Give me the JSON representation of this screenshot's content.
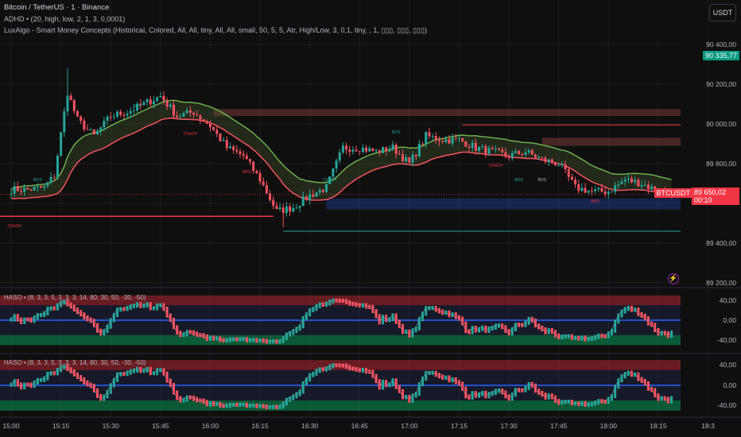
{
  "header": {
    "symbol_title": "Bitcoin / TetherUS · 1 · Binance",
    "indicator_1": "ADHD • (20, high, low, 2, 1, 3, 0,0001)",
    "indicator_2": "LuxAlgo - Smart Money Concepts (Historical, Colored, All, All, tiny, All, All, small, 50, 5, 5, Atr, High/Low, 3, 0,1, tiny, , 1, ▯▯▯, ▯▯▯, ▯▯▯)",
    "currency_button": "USDT"
  },
  "price_axis": {
    "labels": [
      "90 400,00",
      "90 200,00",
      "90 000,00",
      "89 800,00",
      "89 400,00",
      "89 200,00"
    ],
    "values": [
      90400,
      90200,
      90000,
      89800,
      89400,
      89200
    ]
  },
  "price_tags": {
    "high_tag": "90 335,77",
    "symbol_tag": "BTCUSDT",
    "last_price": "89 650,02",
    "countdown": "00:10"
  },
  "oscillator_panes": [
    {
      "title": "HASO • (8, 3, 3, 5, 3, 3, 3, 14, 80, 30, 50, -30, -50)",
      "labels": [
        "40,00",
        "0,00",
        "-40,00"
      ]
    },
    {
      "title": "HASO • (8, 3, 3, 5, 3, 3, 3, 14, 80, 30, 50, -30, -50)",
      "labels": [
        "40,00",
        "0,00",
        "-40,00"
      ]
    }
  ],
  "time_axis": [
    "15:00",
    "15:15",
    "15:30",
    "15:45",
    "16:00",
    "16:15",
    "16:30",
    "16:45",
    "17:00",
    "17:15",
    "17:30",
    "17:45",
    "18:00",
    "18:15",
    "18:3"
  ],
  "smc_labels": [
    {
      "text": "BOS",
      "color": "#26a69a",
      "minute": 8,
      "price": 89730
    },
    {
      "text": "BOS",
      "color": "#26a69a",
      "minute": 38,
      "price": 90100
    },
    {
      "text": "CHoCH",
      "color": "#f23645",
      "minute": 54,
      "price": 89960
    },
    {
      "text": "BOS",
      "color": "#f23645",
      "minute": 71,
      "price": 89770
    },
    {
      "text": "CHoCH",
      "color": "#26a69a",
      "minute": 96,
      "price": 89730
    },
    {
      "text": "CHoCH",
      "color": "#f23645",
      "minute": 1,
      "price": 89495
    },
    {
      "text": "BOS",
      "color": "#26a69a",
      "minute": 116,
      "price": 89970
    },
    {
      "text": "CHoCH",
      "color": "#f23645",
      "minute": 146,
      "price": 89800
    },
    {
      "text": "BOS",
      "color": "#26a69a",
      "minute": 153,
      "price": 89730
    },
    {
      "text": "BOS",
      "color": "#b2b5be",
      "minute": 160,
      "price": 89730
    },
    {
      "text": "BOS",
      "color": "#f23645",
      "minute": 176,
      "price": 89620
    }
  ],
  "colors": {
    "up": "#26a69a",
    "down": "#f7525f",
    "background": "#0f0f0f",
    "tag_green": "#089981",
    "tag_red": "#f23645"
  },
  "chart_data": {
    "type": "candlestick",
    "interval_minutes": 1,
    "start_time": "15:00",
    "keyframes_minute": [
      0,
      5,
      10,
      13,
      17,
      20,
      25,
      30,
      35,
      40,
      45,
      50,
      55,
      60,
      65,
      70,
      75,
      80,
      85,
      90,
      95,
      100,
      105,
      110,
      115,
      120,
      125,
      130,
      135,
      140,
      145,
      150,
      155,
      160,
      165,
      170,
      175,
      180,
      185,
      190,
      195,
      199
    ],
    "keyframes_close": [
      89670,
      89670,
      89680,
      89740,
      90160,
      90020,
      89940,
      90040,
      90060,
      90100,
      90140,
      90040,
      90060,
      89990,
      89880,
      89840,
      89720,
      89560,
      89580,
      89640,
      89680,
      89880,
      89880,
      89860,
      89880,
      89800,
      89940,
      89920,
      89920,
      89880,
      89860,
      89840,
      89860,
      89820,
      89800,
      89680,
      89660,
      89660,
      89720,
      89700,
      89660,
      89650
    ],
    "ylim": [
      89150,
      90500
    ],
    "zones": [
      {
        "kind": "supply",
        "from_minute": 61,
        "top": 90075,
        "bottom": 90040
      },
      {
        "kind": "supply",
        "from_minute": 160,
        "top": 89930,
        "bottom": 89890
      },
      {
        "kind": "demand",
        "from_minute": 95,
        "top": 89625,
        "bottom": 89570
      }
    ],
    "oscillator_range": [
      -50,
      50
    ]
  }
}
